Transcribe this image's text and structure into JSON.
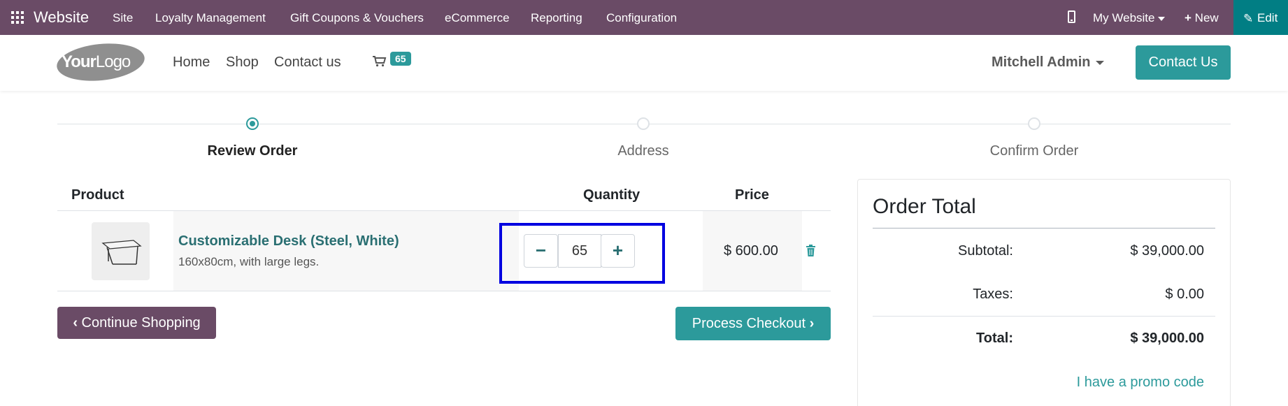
{
  "topbar": {
    "brand": "Website",
    "menu": [
      "Site",
      "Loyalty Management",
      "Gift Coupons & Vouchers",
      "eCommerce",
      "Reporting",
      "Configuration"
    ],
    "website_selector": "My Website",
    "new_label": "New",
    "edit_label": "Edit",
    "bg_color": "#6a4b66",
    "edit_bg_color": "#017e84"
  },
  "header": {
    "logo_text_bold": "Your",
    "logo_text_light": "Logo",
    "nav": [
      "Home",
      "Shop",
      "Contact us"
    ],
    "cart_count": "65",
    "user_name": "Mitchell Admin",
    "contact_button": "Contact Us"
  },
  "steps": [
    {
      "label": "Review Order",
      "active": true
    },
    {
      "label": "Address",
      "active": false
    },
    {
      "label": "Confirm Order",
      "active": false
    }
  ],
  "cart_table": {
    "headers": {
      "product": "Product",
      "quantity": "Quantity",
      "price": "Price"
    },
    "rows": [
      {
        "name": "Customizable Desk (Steel, White)",
        "description": "160x80cm, with large legs.",
        "quantity": "65",
        "price": "$ 600.00"
      }
    ]
  },
  "actions": {
    "continue": "Continue Shopping",
    "checkout": "Process Checkout"
  },
  "order_total": {
    "title": "Order Total",
    "subtotal_label": "Subtotal:",
    "subtotal_value": "$ 39,000.00",
    "taxes_label": "Taxes:",
    "taxes_value": "$ 0.00",
    "total_label": "Total:",
    "total_value": "$ 39,000.00",
    "promo_link": "I have a promo code"
  },
  "colors": {
    "accent": "#2c9a9b",
    "highlight": "#0000e0"
  }
}
